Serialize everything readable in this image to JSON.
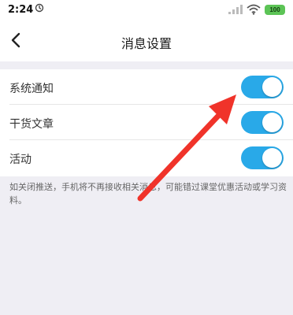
{
  "status_bar": {
    "time": "2:24",
    "battery": "100",
    "icons": [
      "sync-icon",
      "signal-icon",
      "wifi-icon",
      "battery-icon"
    ]
  },
  "header": {
    "title": "消息设置",
    "back_icon": "chevron-left-icon"
  },
  "settings": {
    "items": [
      {
        "label": "系统通知",
        "enabled": true
      },
      {
        "label": "干货文章",
        "enabled": true
      },
      {
        "label": "活动",
        "enabled": true
      }
    ],
    "note": "如关闭推送，手机将不再接收相关消息，可能错过课堂优惠活动或学习资料。"
  },
  "colors": {
    "toggle_on": "#29a9e8",
    "page_background": "#efeef4",
    "annotation_arrow": "#f0332a",
    "battery": "#5cc456"
  }
}
